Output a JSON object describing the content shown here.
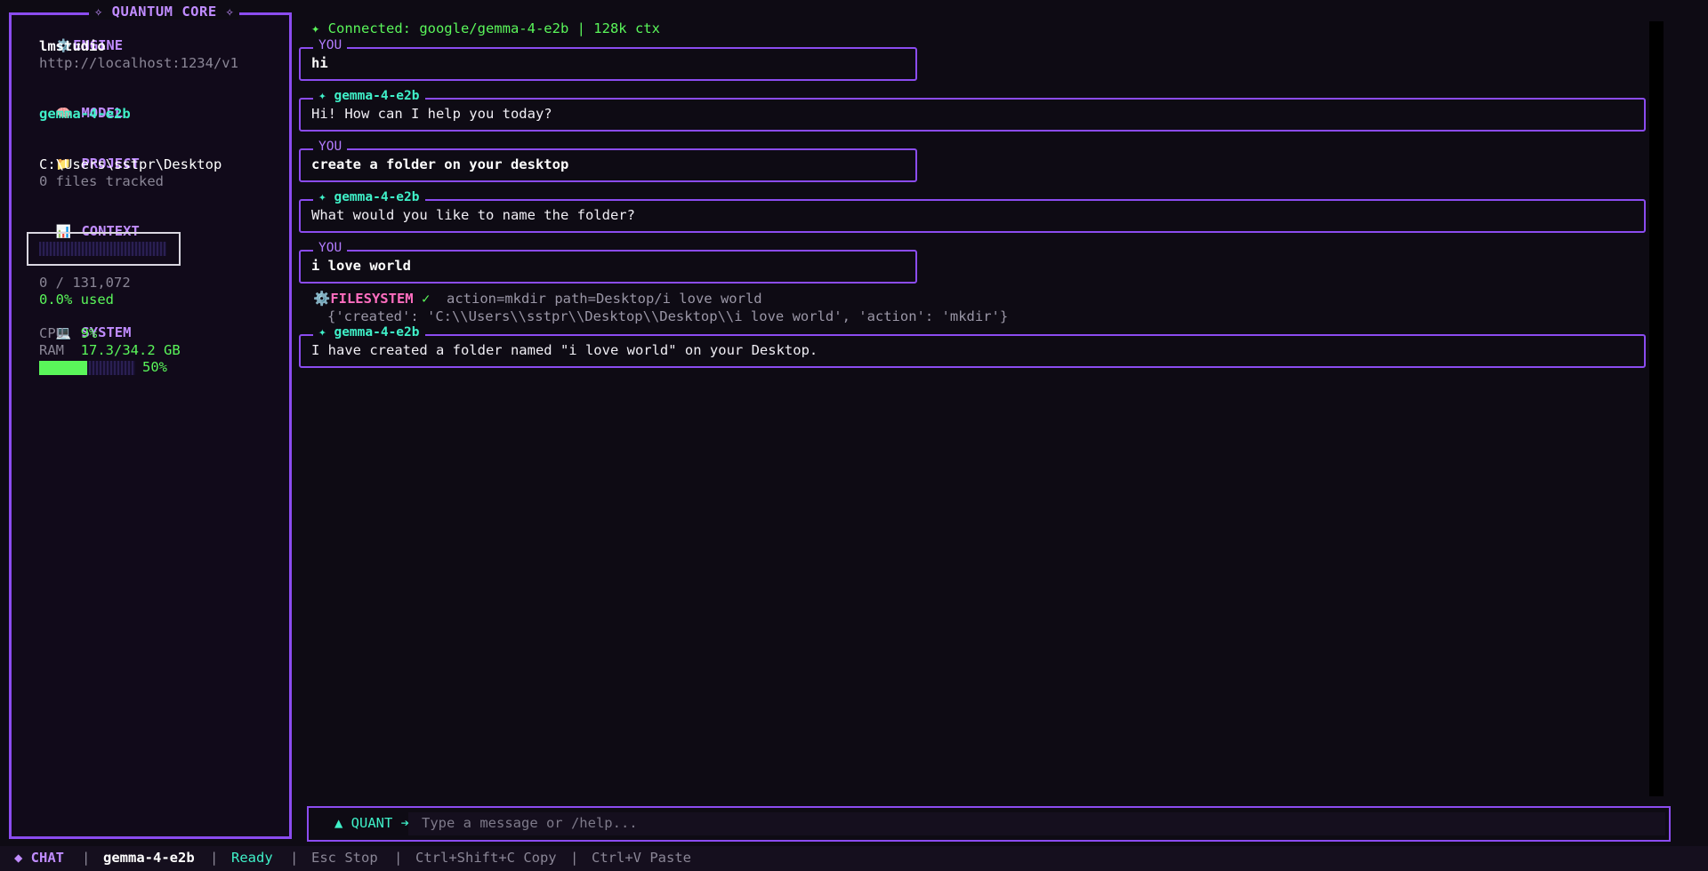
{
  "sidebar": {
    "title": "✧ QUANTUM CORE ✧",
    "engine": {
      "heading": "ENGINE",
      "icon": "⚙️",
      "name": "lmstudio",
      "url": "http://localhost:1234/v1"
    },
    "model": {
      "heading": "MODEL",
      "icon": "🧠",
      "name": "gemma-4-e2b"
    },
    "project": {
      "heading": "PROJECT",
      "icon": "📁",
      "path": "C:\\Users\\sstpr\\Desktop",
      "files": "0 files tracked"
    },
    "context": {
      "heading": "CONTEXT",
      "icon": "📊",
      "tokens": "0 / 131,072",
      "used": "0.0% used"
    },
    "system": {
      "heading": "SYSTEM",
      "icon": "💻",
      "cpu_label": "CPU",
      "cpu_value": "9%",
      "ram_label": "RAM",
      "ram_value": "17.3/34.2 GB",
      "ram_percent": "50%",
      "ram_fraction": 0.5
    }
  },
  "status": {
    "text": "✦ Connected: google/gemma-4-e2b | 128k ctx"
  },
  "messages": [
    {
      "role": "you",
      "label": "YOU",
      "text": "hi"
    },
    {
      "role": "bot",
      "label": "✦ gemma-4-e2b",
      "text": "Hi! How can I help you today?"
    },
    {
      "role": "you",
      "label": "YOU",
      "text": "create a folder on your desktop"
    },
    {
      "role": "bot",
      "label": "✦ gemma-4-e2b",
      "text": "What would you like to name the folder?"
    },
    {
      "role": "you",
      "label": "YOU",
      "text": "i love world"
    },
    {
      "role": "bot",
      "label": "✦ gemma-4-e2b",
      "text": "I have created a folder named \"i love world\" on your Desktop."
    }
  ],
  "tool": {
    "icon": "⚙️",
    "name": "FILESYSTEM",
    "check": "✓",
    "args": "action=mkdir path=Desktop/i love world",
    "result": "{'created': 'C:\\\\Users\\\\sstpr\\\\Desktop\\\\Desktop\\\\i love world', 'action': 'mkdir'}"
  },
  "input": {
    "prompt": "▲ QUANT ➔",
    "placeholder": "Type a message or /help...",
    "value": ""
  },
  "footer": {
    "mode": "◆ CHAT",
    "model": "gemma-4-e2b",
    "state": "Ready",
    "hint_stop": "Esc Stop",
    "hint_copy": "Ctrl+Shift+C Copy",
    "hint_paste": "Ctrl+V Paste",
    "sep": "|"
  },
  "colors": {
    "accent": "#8b4cf0",
    "teal": "#3ff0c8",
    "green": "#5af65a",
    "pink": "#ff6ec0",
    "background": "#0e0b14"
  }
}
